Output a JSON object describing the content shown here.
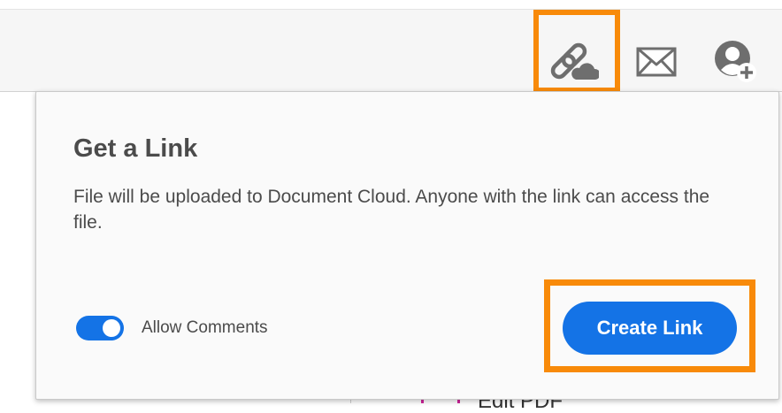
{
  "toolbar": {
    "icons": {
      "share_link": "link-cloud-icon",
      "email": "envelope-icon",
      "add_user": "add-user-icon"
    }
  },
  "background": {
    "partial_tool_label": "Edit PDF"
  },
  "popover": {
    "title": "Get a Link",
    "description": "File will be uploaded to Document Cloud. Anyone with the link can access the file.",
    "allow_comments": {
      "label": "Allow Comments",
      "enabled": true
    },
    "create_button_label": "Create Link"
  },
  "colors": {
    "accent_blue": "#1473e6",
    "highlight_orange": "#f88a09",
    "icon_gray": "#6e6e6e",
    "text_gray": "#4b4b4b"
  }
}
